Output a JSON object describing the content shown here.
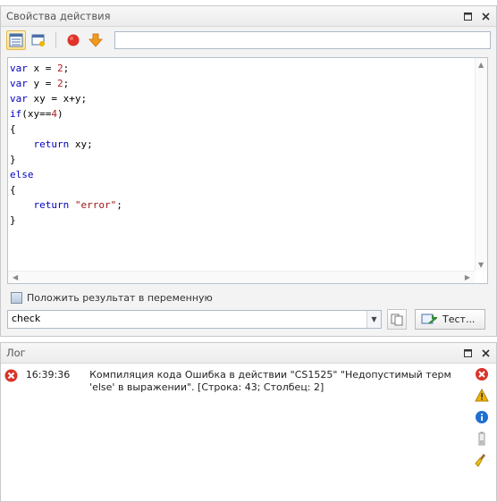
{
  "actions_panel": {
    "title": "Свойства действия",
    "toolbar_input_value": "",
    "code_lines": [
      [
        {
          "t": "var",
          "c": "kw"
        },
        {
          "t": " x = "
        },
        {
          "t": "2",
          "c": "num"
        },
        {
          "t": ";"
        }
      ],
      [
        {
          "t": "var",
          "c": "kw"
        },
        {
          "t": " y = "
        },
        {
          "t": "2",
          "c": "num"
        },
        {
          "t": ";"
        }
      ],
      [
        {
          "t": "var",
          "c": "kw"
        },
        {
          "t": " xy = x+y;"
        }
      ],
      [
        {
          "t": "if",
          "c": "kw"
        },
        {
          "t": "(xy=="
        },
        {
          "t": "4",
          "c": "num"
        },
        {
          "t": ")"
        }
      ],
      [
        {
          "t": "{"
        }
      ],
      [
        {
          "t": "    "
        },
        {
          "t": "return",
          "c": "kw"
        },
        {
          "t": " xy;"
        }
      ],
      [
        {
          "t": "}"
        }
      ],
      [
        {
          "t": "else",
          "c": "kw"
        }
      ],
      [
        {
          "t": "{"
        }
      ],
      [
        {
          "t": "    "
        },
        {
          "t": "return",
          "c": "kw"
        },
        {
          "t": " "
        },
        {
          "t": "\"error\"",
          "c": "str"
        },
        {
          "t": ";"
        }
      ],
      [
        {
          "t": "}"
        }
      ]
    ],
    "store_result_label": "Положить результат в переменную",
    "variable_value": "check",
    "test_label": "Тест..."
  },
  "log_panel": {
    "title": "Лог",
    "entries": [
      {
        "time": "16:39:36",
        "message": "Компиляция кода  Ошибка в действии \"CS1525\" \"Недопустимый терм 'else' в выражении\". [Строка: 43; Столбец: 2]"
      }
    ]
  },
  "icons": {
    "toolbar": [
      "code-view-icon",
      "settings-view-icon",
      "stop-icon",
      "download-arrow-icon"
    ],
    "log_filters": [
      "error-filter-icon",
      "warning-filter-icon",
      "info-filter-icon",
      "battery-icon",
      "clear-broom-icon"
    ]
  },
  "colors": {
    "keyword": "#0000c0",
    "string": "#a31515",
    "number": "#b02020",
    "error": "#d9342b",
    "warning": "#f0b400",
    "info": "#1f6fd1"
  }
}
